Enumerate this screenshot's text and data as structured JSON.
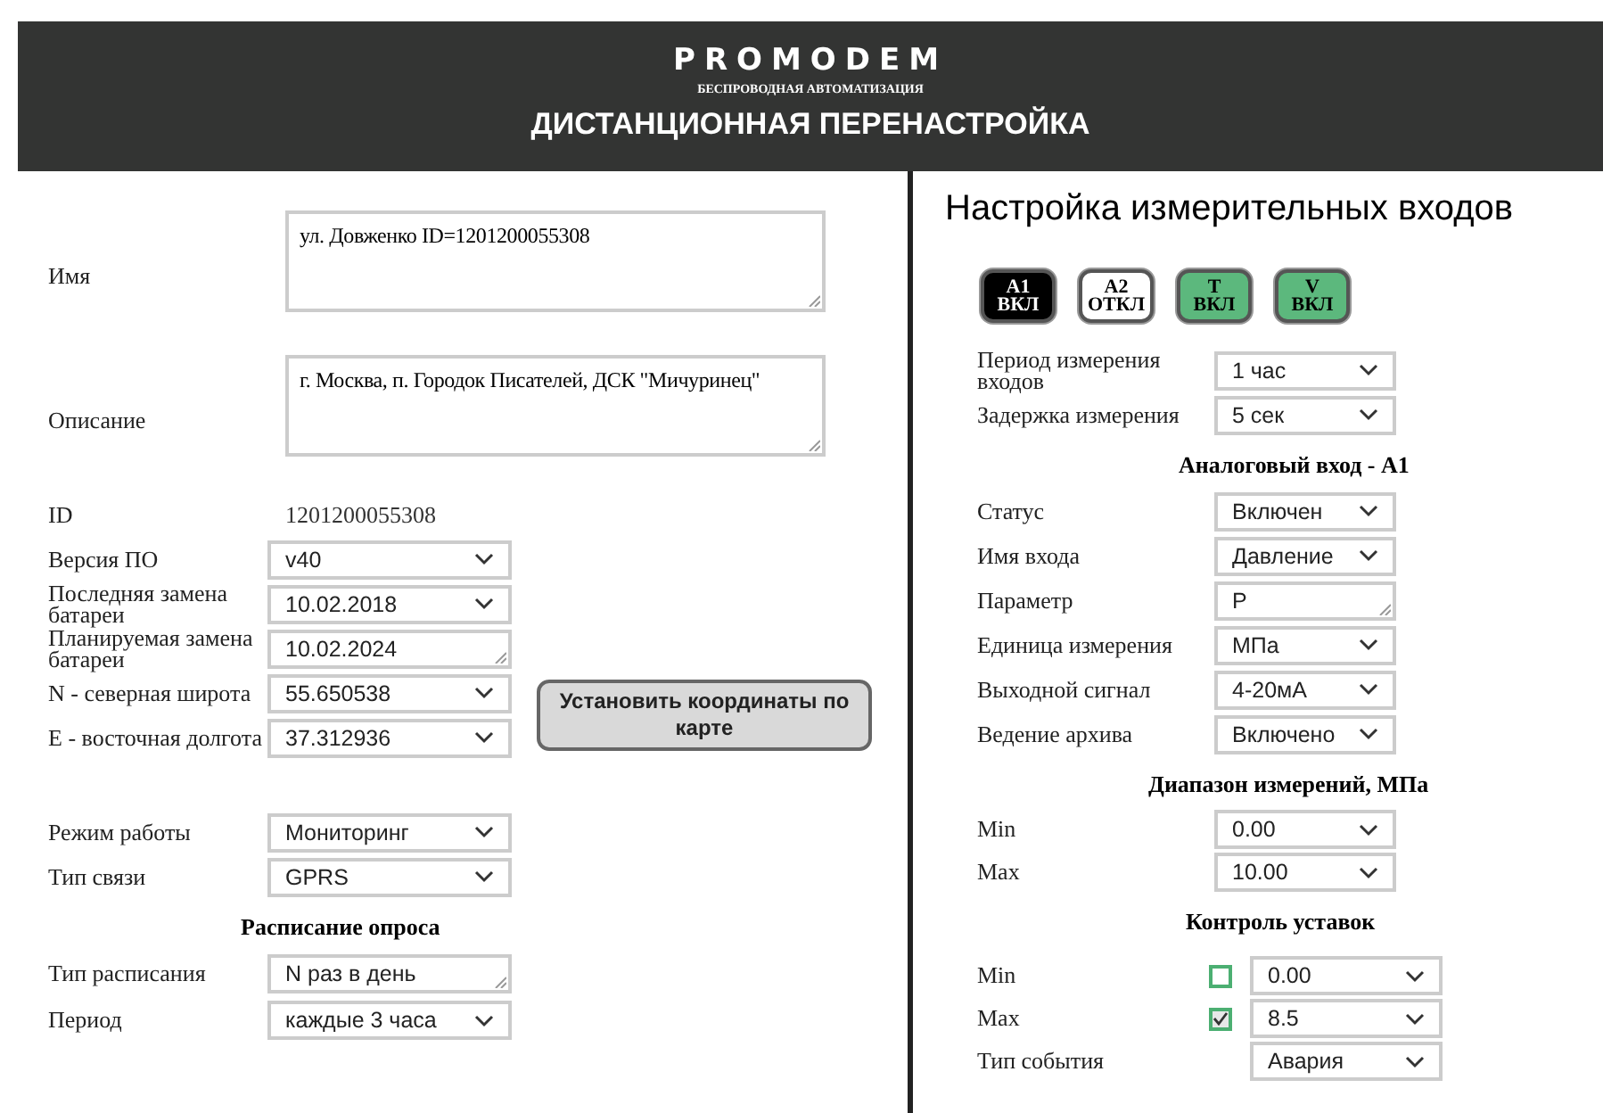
{
  "header": {
    "logo": "PROMODEM",
    "subtitle": "БЕСПРОВОДНАЯ АВТОМАТИЗАЦИЯ",
    "title": "ДИСТАНЦИОННАЯ ПЕРЕНАСТРОЙКА"
  },
  "left": {
    "top_fields": [
      {
        "label": "Имя",
        "kind": "textarea",
        "value": "ул. Довженко ID=1201200055308"
      },
      {
        "label": "Описание",
        "kind": "textarea",
        "value": "г. Москва, п. Городок Писателей, ДСК \"Мичуринец\""
      },
      {
        "label": "ID",
        "kind": "plain",
        "value": "1201200055308"
      },
      {
        "label": "Версия ПО",
        "kind": "select",
        "value": "v40"
      },
      {
        "label": "Последняя замена батареи",
        "kind": "select",
        "value": "10.02.2018"
      },
      {
        "label": "Планируемая замена батареи",
        "kind": "input",
        "value": "10.02.2024"
      },
      {
        "label": "N - северная широта",
        "kind": "select",
        "value": "55.650538"
      },
      {
        "label": "E - восточная долгота",
        "kind": "select",
        "value": "37.312936"
      }
    ],
    "map_button": "Установить координаты по карте",
    "mode_fields": [
      {
        "label": "Режим работы",
        "kind": "select",
        "value": "Мониторинг"
      },
      {
        "label": "Тип связи",
        "kind": "select",
        "value": "GPRS"
      }
    ],
    "schedule": {
      "heading": "Расписание опроса",
      "fields": [
        {
          "label": "Тип расписания",
          "kind": "input",
          "value": "N раз в день"
        },
        {
          "label": "Период",
          "kind": "select",
          "value": "каждые 3 часа"
        }
      ]
    }
  },
  "right": {
    "title": "Настройка измерительных входов",
    "channels": [
      {
        "name": "A1",
        "state": "ВКЛ",
        "selected": true,
        "on": true
      },
      {
        "name": "A2",
        "state": "ОТКЛ",
        "selected": false,
        "on": false
      },
      {
        "name": "T",
        "state": "ВКЛ",
        "selected": false,
        "on": true
      },
      {
        "name": "V",
        "state": "ВКЛ",
        "selected": false,
        "on": true
      }
    ],
    "general_fields": [
      {
        "label": "Период измерения входов",
        "kind": "select",
        "value": "1 час"
      },
      {
        "label": "Задержка измерения",
        "kind": "select",
        "value": "5 сек"
      }
    ],
    "analog": {
      "heading": "Аналоговый вход - A1",
      "fields": [
        {
          "label": "Статус",
          "kind": "select",
          "value": "Включен"
        },
        {
          "label": "Имя входа",
          "kind": "select",
          "value": "Давление"
        },
        {
          "label": "Параметр",
          "kind": "input",
          "value": "P"
        },
        {
          "label": "Единица измерения",
          "kind": "select",
          "value": "МПа"
        },
        {
          "label": "Выходной сигнал",
          "kind": "select",
          "value": "4-20мА"
        },
        {
          "label": "Ведение архива",
          "kind": "select",
          "value": "Включено"
        }
      ]
    },
    "range": {
      "heading": "Диапазон измерений, МПа",
      "fields": [
        {
          "label": "Min",
          "kind": "select",
          "value": "0.00"
        },
        {
          "label": "Max",
          "kind": "select",
          "value": "10.00"
        }
      ]
    },
    "setpoints": {
      "heading": "Контроль уставок",
      "rows": [
        {
          "label": "Min",
          "kind": "check",
          "checked": false,
          "value": "0.00"
        },
        {
          "label": "Max",
          "kind": "check",
          "checked": true,
          "value": "8.5"
        },
        {
          "label": "Тип события",
          "kind": "select",
          "value": "Авария"
        }
      ]
    }
  }
}
